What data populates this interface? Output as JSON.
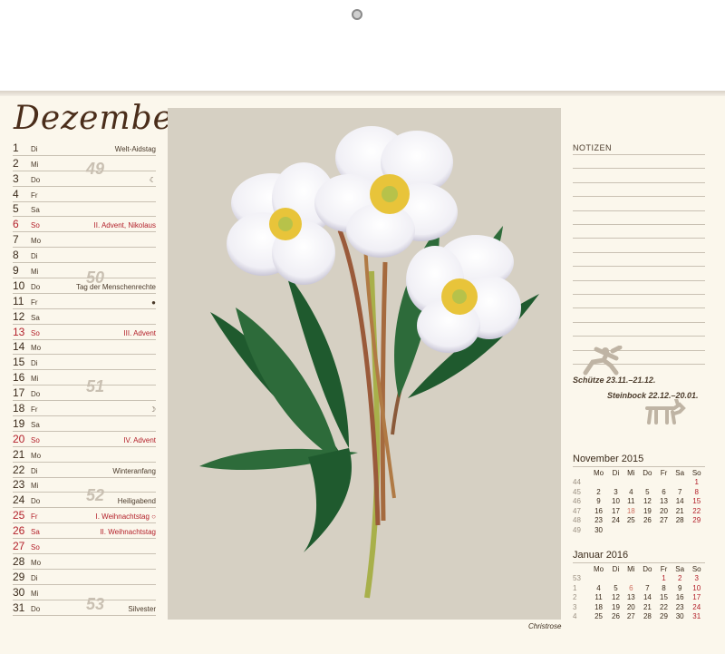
{
  "month": "Dezember",
  "days": [
    {
      "n": "1",
      "wd": "Di",
      "ev": "Welt-Aidstag"
    },
    {
      "n": "2",
      "wd": "Mi",
      "ev": ""
    },
    {
      "n": "3",
      "wd": "Do",
      "ev": "",
      "moon": "☾"
    },
    {
      "n": "4",
      "wd": "Fr",
      "ev": ""
    },
    {
      "n": "5",
      "wd": "Sa",
      "ev": ""
    },
    {
      "n": "6",
      "wd": "So",
      "ev": "II. Advent, Nikolaus",
      "red": true
    },
    {
      "n": "7",
      "wd": "Mo",
      "ev": ""
    },
    {
      "n": "8",
      "wd": "Di",
      "ev": ""
    },
    {
      "n": "9",
      "wd": "Mi",
      "ev": ""
    },
    {
      "n": "10",
      "wd": "Do",
      "ev": "Tag der Menschenrechte"
    },
    {
      "n": "11",
      "wd": "Fr",
      "ev": "",
      "moon": "●"
    },
    {
      "n": "12",
      "wd": "Sa",
      "ev": ""
    },
    {
      "n": "13",
      "wd": "So",
      "ev": "III. Advent",
      "red": true
    },
    {
      "n": "14",
      "wd": "Mo",
      "ev": ""
    },
    {
      "n": "15",
      "wd": "Di",
      "ev": ""
    },
    {
      "n": "16",
      "wd": "Mi",
      "ev": ""
    },
    {
      "n": "17",
      "wd": "Do",
      "ev": ""
    },
    {
      "n": "18",
      "wd": "Fr",
      "ev": "",
      "moon": "☽"
    },
    {
      "n": "19",
      "wd": "Sa",
      "ev": ""
    },
    {
      "n": "20",
      "wd": "So",
      "ev": "IV. Advent",
      "red": true
    },
    {
      "n": "21",
      "wd": "Mo",
      "ev": ""
    },
    {
      "n": "22",
      "wd": "Di",
      "ev": "Winteranfang"
    },
    {
      "n": "23",
      "wd": "Mi",
      "ev": ""
    },
    {
      "n": "24",
      "wd": "Do",
      "ev": "Heiligabend"
    },
    {
      "n": "25",
      "wd": "Fr",
      "ev": "I. Weihnachtstag ○",
      "red": true
    },
    {
      "n": "26",
      "wd": "Sa",
      "ev": "II. Weihnachtstag",
      "red": true
    },
    {
      "n": "27",
      "wd": "So",
      "ev": "",
      "red": true
    },
    {
      "n": "28",
      "wd": "Mo",
      "ev": ""
    },
    {
      "n": "29",
      "wd": "Di",
      "ev": ""
    },
    {
      "n": "30",
      "wd": "Mi",
      "ev": ""
    },
    {
      "n": "31",
      "wd": "Do",
      "ev": "Silvester"
    }
  ],
  "weeks": [
    "49",
    "50",
    "51",
    "52",
    "53"
  ],
  "caption": "Christrose",
  "notes_label": "NOTIZEN",
  "zodiac": {
    "line1": "Schütze 23.11.–21.12.",
    "line2": "Steinbock 22.12.–20.01."
  },
  "nov": {
    "title": "November 2015",
    "head": [
      "Mo",
      "Di",
      "Mi",
      "Do",
      "Fr",
      "Sa",
      "So"
    ],
    "rows": [
      [
        "44",
        "",
        "",
        "",
        "",
        "",
        "",
        "1"
      ],
      [
        "45",
        "2",
        "3",
        "4",
        "5",
        "6",
        "7",
        "8"
      ],
      [
        "46",
        "9",
        "10",
        "11",
        "12",
        "13",
        "14",
        "15"
      ],
      [
        "47",
        "16",
        "17",
        "18",
        "19",
        "20",
        "21",
        "22"
      ],
      [
        "48",
        "23",
        "24",
        "25",
        "26",
        "27",
        "28",
        "29"
      ],
      [
        "49",
        "30",
        "",
        "",
        "",
        "",
        "",
        ""
      ]
    ]
  },
  "jan": {
    "title": "Januar 2016",
    "head": [
      "Mo",
      "Di",
      "Mi",
      "Do",
      "Fr",
      "Sa",
      "So"
    ],
    "rows": [
      [
        "53",
        "",
        "",
        "",
        "",
        "1",
        "2",
        "3"
      ],
      [
        "1",
        "4",
        "5",
        "6",
        "7",
        "8",
        "9",
        "10"
      ],
      [
        "2",
        "11",
        "12",
        "13",
        "14",
        "15",
        "16",
        "17"
      ],
      [
        "3",
        "18",
        "19",
        "20",
        "21",
        "22",
        "23",
        "24"
      ],
      [
        "4",
        "25",
        "26",
        "27",
        "28",
        "29",
        "30",
        "31"
      ]
    ]
  }
}
